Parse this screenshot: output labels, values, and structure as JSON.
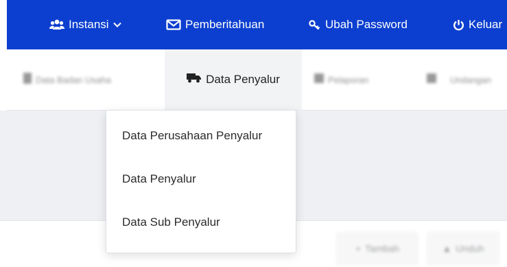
{
  "colors": {
    "navbar": "#0c3fd0",
    "active_tab_bg": "#f2f3f5",
    "content_bg": "#eef0f3"
  },
  "navbar": {
    "instansi": {
      "label": "Instansi",
      "icon": "users-icon"
    },
    "pemberitahuan": {
      "label": "Pemberitahuan",
      "icon": "envelope-icon"
    },
    "ubah_password": {
      "label": "Ubah Password",
      "icon": "key-icon"
    },
    "keluar": {
      "label": "Keluar",
      "icon": "power-icon"
    }
  },
  "subnav": {
    "data_badan_usaha": {
      "label": "Data Badan Usaha",
      "icon": "building-icon"
    },
    "data_penyalur": {
      "label": "Data Penyalur",
      "icon": "truck-icon"
    },
    "pelaporan": {
      "label": "Pelaporan",
      "icon": "report-icon"
    },
    "undangan": {
      "label": "Undangan",
      "icon": "mail-icon"
    }
  },
  "dropdown": {
    "items": [
      "Data Perusahaan Penyalur",
      "Data Penyalur",
      "Data Sub Penyalur"
    ]
  },
  "actions": {
    "tambah": "Tambah",
    "unduh": "Unduh"
  }
}
